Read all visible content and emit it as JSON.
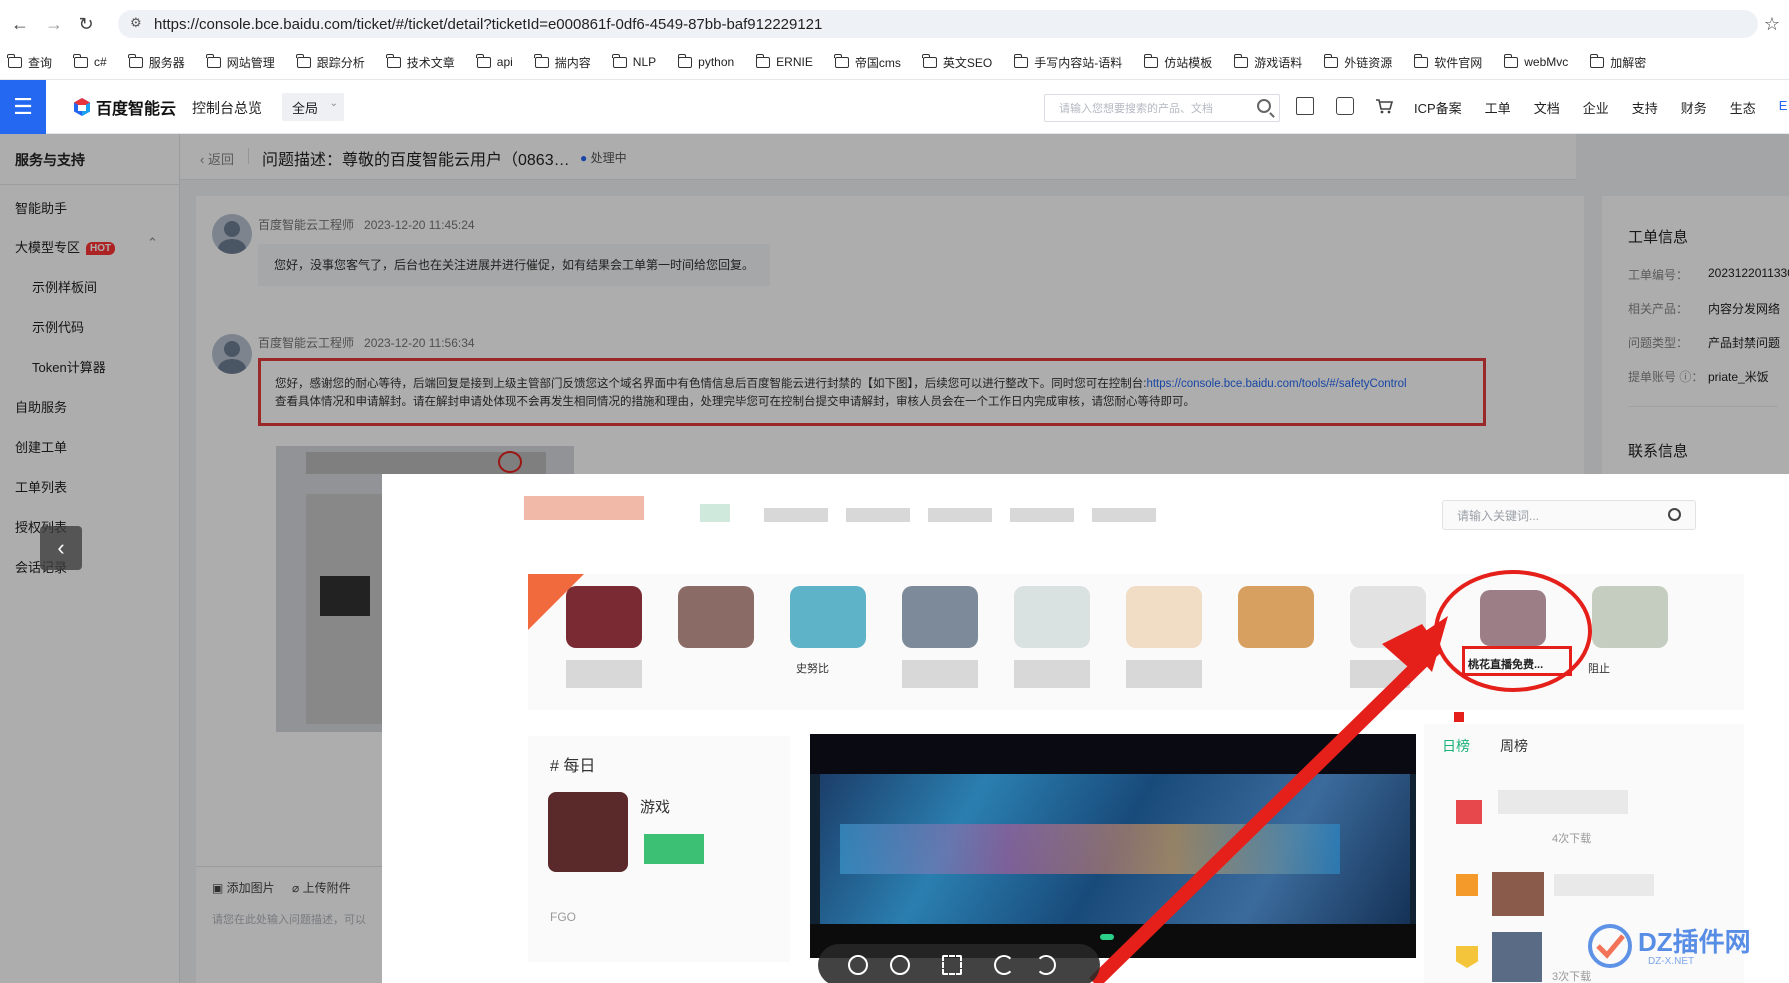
{
  "browser": {
    "url": "https://console.bce.baidu.com/ticket/#/ticket/detail?ticketId=e000861f-0df6-4549-87bb-baf912229121",
    "bookmarks": [
      "查询",
      "c#",
      "服务器",
      "网站管理",
      "跟踪分析",
      "技术文章",
      "api",
      "揣内容",
      "NLP",
      "python",
      "ERNIE",
      "帝国cms",
      "英文SEO",
      "手写内容站-语料",
      "仿站模板",
      "游戏语料",
      "外链资源",
      "软件官网",
      "webMvc",
      "加解密"
    ]
  },
  "header": {
    "logo": "百度智能云",
    "console": "控制台总览",
    "scope": "全局",
    "search_placeholder": "请输入您想要搜索的产品、文档",
    "nav": [
      "ICP备案",
      "工单",
      "文档",
      "企业",
      "支持",
      "财务",
      "生态",
      "E"
    ]
  },
  "sidebar": {
    "title": "服务与支持",
    "items": [
      "智能助手",
      "大模型专区",
      "示例样板间",
      "示例代码",
      "Token计算器",
      "自助服务",
      "创建工单",
      "工单列表",
      "授权列表",
      "会话记录"
    ],
    "hot": "HOT"
  },
  "ticket": {
    "back": "返回",
    "title": "问题描述：尊敬的百度智能云用户（0863…",
    "status": "处理中",
    "messages": [
      {
        "author": "百度智能云工程师",
        "time": "2023-12-20 11:45:24",
        "text": "您好，没事您客气了，后台也在关注进展并进行催促，如有结果会工单第一时间给您回复。"
      },
      {
        "author": "百度智能云工程师",
        "time": "2023-12-20 11:56:34",
        "text_part1": "您好，感谢您的耐心等待，后端回复是接到上级主管部门反馈您这个域名界面中有色情信息后百度智能云进行封禁的【如下图】，后续您可以进行整改下。同时您可在控制台:",
        "link": "https://console.bce.baidu.com/tools/#/safetyControl",
        "text_part2": "查看具体情况和申请解封。请在解封申请处体现不会再发生相同情况的措施和理由，处理完毕您可在控制台提交申请解封，审核人员会在一个工作日内完成审核，请您耐心等待即可。"
      }
    ],
    "input_tools": [
      "添加图片",
      "上传附件"
    ],
    "input_placeholder": "请您在此处输入问题描述，可以"
  },
  "info_panel": {
    "title": "工单信息",
    "rows": [
      {
        "label": "工单编号：",
        "value": "2023122011330"
      },
      {
        "label": "相关产品：",
        "value": "内容分发网络"
      },
      {
        "label": "问题类型：",
        "value": "产品封禁问题"
      },
      {
        "label": "提单账号 ⓘ：",
        "value": "priate_米饭"
      }
    ],
    "contact_title": "联系信息"
  },
  "preview": {
    "search_placeholder": "请输入关键词...",
    "app_labels": [
      "史努比",
      "桃花直播免费...",
      "阻止"
    ],
    "section": "# 每日",
    "section_item": "游戏",
    "tabs": [
      "日榜",
      "周榜"
    ],
    "rank_meta": [
      "4次下载",
      "3次下载"
    ],
    "footer_text": "FGO"
  },
  "watermark": {
    "text": "DZ插件网",
    "sub": "DZ-X.NET"
  },
  "colors": {
    "accent": "#2468f2",
    "mark_red": "#e5201b",
    "hot": "#ff3333"
  }
}
